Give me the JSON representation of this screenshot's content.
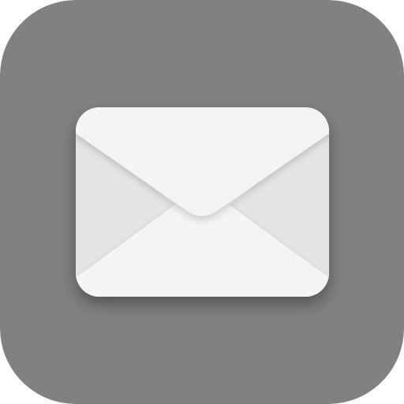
{
  "app_icon": {
    "name": "mail-icon",
    "background_color": "#818181",
    "envelope_color": "#f4f4f4",
    "envelope_side_color": "#e5e5e5",
    "envelope_shadow_color": "#000000"
  }
}
